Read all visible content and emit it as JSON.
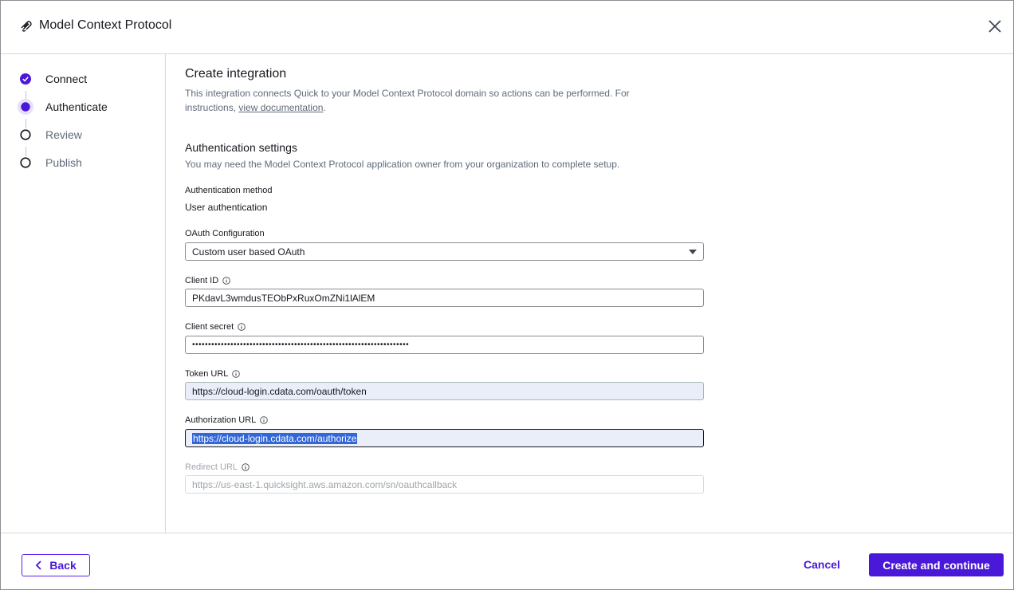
{
  "window": {
    "title": "Model Context Protocol"
  },
  "icons": {
    "logo": "mcp-logo-icon",
    "close": "close-icon",
    "info": "info-icon",
    "dropdown": "caret-down-icon",
    "back": "chevron-left-icon",
    "check": "check-icon"
  },
  "colors": {
    "accent": "#4a18d8",
    "text": "#16191f",
    "muted": "#5f6b7a",
    "tinted_input": "#e9eef8"
  },
  "steps": [
    {
      "label": "Connect",
      "state": "completed"
    },
    {
      "label": "Authenticate",
      "state": "current"
    },
    {
      "label": "Review",
      "state": "pending"
    },
    {
      "label": "Publish",
      "state": "pending"
    }
  ],
  "main": {
    "title": "Create integration",
    "description_prefix": "This integration connects Quick to your Model Context Protocol domain so actions can be performed. For instructions, ",
    "description_link": "view documentation",
    "description_suffix": ".",
    "auth_settings_title": "Authentication settings",
    "auth_settings_desc": "You may need the Model Context Protocol application owner from your organization to complete setup.",
    "auth_method_label": "Authentication method",
    "auth_method_value": "User authentication",
    "oauth_config_label": "OAuth Configuration",
    "oauth_config_value": "Custom user based OAuth",
    "client_id_label": "Client ID",
    "client_id_value": "PKdavL3wmdusTEObPxRuxOmZNi1lAlEM",
    "client_secret_label": "Client secret",
    "client_secret_value": "••••••••••••••••••••••••••••••••••••••••••••••••••••••••••••••••••••",
    "token_url_label": "Token URL",
    "token_url_value": "https://cloud-login.cdata.com/oauth/token",
    "authorization_url_label": "Authorization URL",
    "authorization_url_value": "https://cloud-login.cdata.com/authorize",
    "redirect_url_label": "Redirect URL",
    "redirect_url_placeholder": "https://us-east-1.quicksight.aws.amazon.com/sn/oauthcallback"
  },
  "footer": {
    "back_label": "Back",
    "cancel_label": "Cancel",
    "primary_label": "Create and continue"
  }
}
